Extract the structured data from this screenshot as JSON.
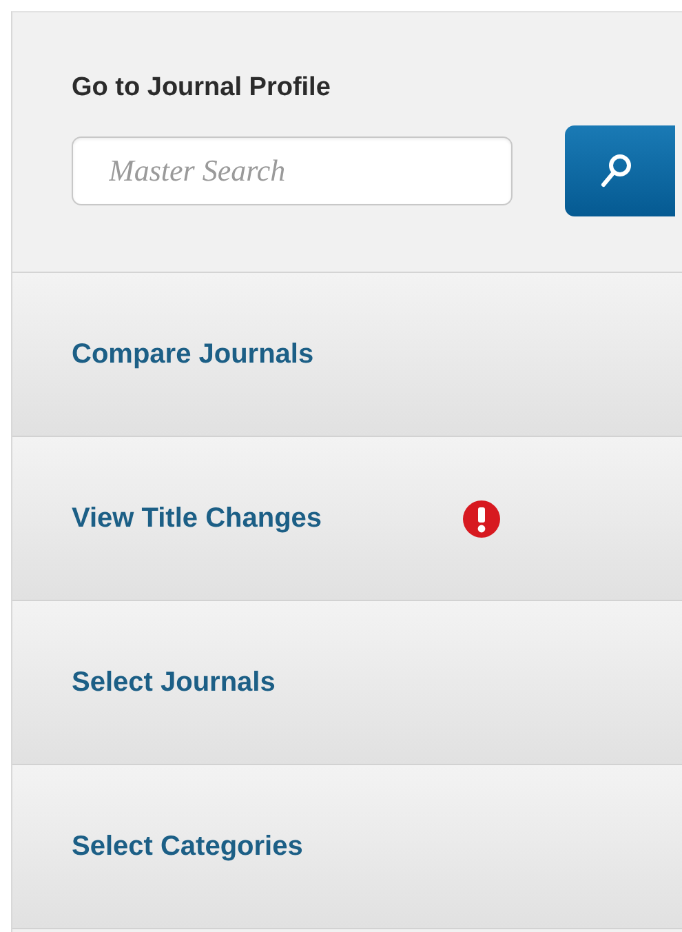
{
  "profile": {
    "heading": "Go to Journal Profile",
    "search": {
      "placeholder": "Master Search"
    }
  },
  "nav": [
    {
      "label": "Compare Journals",
      "alert": false
    },
    {
      "label": "View Title Changes",
      "alert": true
    },
    {
      "label": "Select Journals",
      "alert": false
    },
    {
      "label": "Select Categories",
      "alert": false
    }
  ]
}
